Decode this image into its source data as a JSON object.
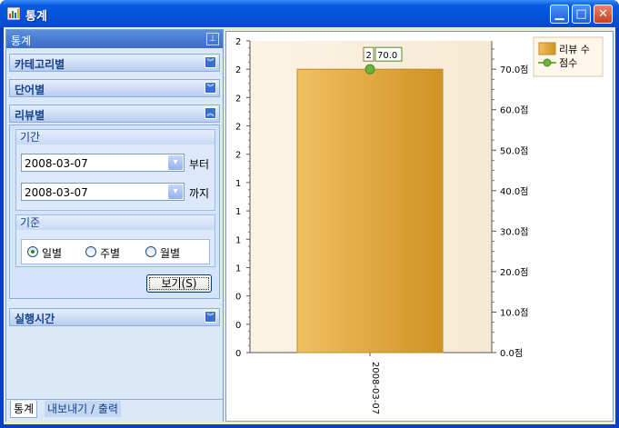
{
  "window": {
    "title": "통계"
  },
  "side_panel": {
    "title": "통계",
    "groups": {
      "category": "카테고리별",
      "word": "단어별",
      "review": "리뷰별",
      "runtime": "실행시간"
    }
  },
  "review": {
    "period_title": "기간",
    "from_date": "2008-03-07",
    "from_suffix": "부터",
    "to_date": "2008-03-07",
    "to_suffix": "까지",
    "basis_title": "기준",
    "radios": [
      {
        "label": "일별",
        "selected": true
      },
      {
        "label": "주별",
        "selected": false
      },
      {
        "label": "월별",
        "selected": false
      }
    ],
    "view_button": "보기(S)"
  },
  "tabs": [
    "통계",
    "내보내기 / 출력"
  ],
  "chart_data": {
    "type": "bar",
    "categories": [
      "2008-03-07"
    ],
    "series": [
      {
        "name": "리뷰 수",
        "type": "bar",
        "axis": "left",
        "values": [
          2
        ],
        "color": "#d9a43a"
      },
      {
        "name": "점수",
        "type": "line",
        "axis": "right",
        "values": [
          70.0
        ],
        "color": "#6db33f"
      }
    ],
    "left_axis": {
      "ylim": [
        0,
        2.2
      ],
      "tick_labels": [
        "0",
        "0",
        "0",
        "1",
        "1",
        "1",
        "1",
        "2",
        "2",
        "2",
        "2",
        "2"
      ]
    },
    "right_axis": {
      "ylim": [
        0,
        77
      ],
      "ticks": [
        0,
        10,
        20,
        30,
        40,
        50,
        60,
        70
      ],
      "tick_labels": [
        "0.0점",
        "10.0점",
        "20.0점",
        "30.0점",
        "40.0점",
        "50.0점",
        "60.0점",
        "70.0점"
      ]
    },
    "data_labels": [
      "2",
      "70.0"
    ],
    "legend": {
      "position": "top-right",
      "entries": [
        "리뷰 수",
        "점수"
      ]
    },
    "xlabel": "",
    "ylabel": "",
    "title": ""
  }
}
